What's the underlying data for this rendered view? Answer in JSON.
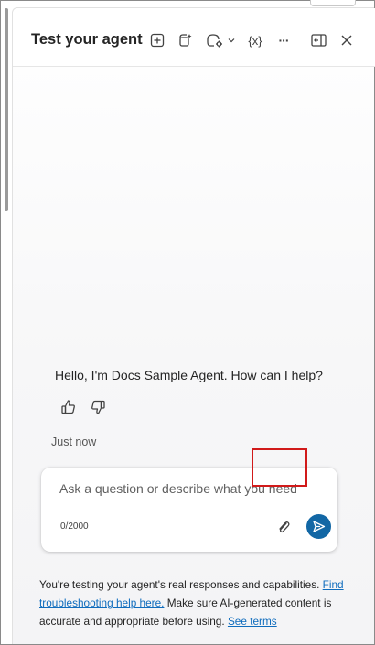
{
  "header": {
    "title": "Test your agent",
    "variables_label": "{x}",
    "more_label": "···"
  },
  "chat": {
    "greeting": "Hello, I'm Docs Sample Agent. How can I help?",
    "timestamp": "Just now"
  },
  "composer": {
    "placeholder": "Ask a question or describe what you need",
    "counter": "0/2000"
  },
  "disclaimer": {
    "text_1": "You're testing your agent's real responses and capabilities. ",
    "link_troubleshooting": "Find troubleshooting help here.",
    "text_2": " Make sure AI-generated content is accurate and appropriate before using. ",
    "link_terms": "See terms"
  },
  "icons": {
    "header": [
      "add-icon",
      "copilot-icon",
      "agent-settings-icon",
      "chevron-down-icon",
      "variables-icon",
      "more-icon",
      "panel-toggle-icon",
      "close-icon"
    ],
    "feedback": [
      "thumbs-up-icon",
      "thumbs-down-icon"
    ],
    "composer": [
      "attach-icon",
      "send-icon"
    ]
  },
  "colors": {
    "accent": "#1267a5",
    "link": "#0f6cbd",
    "highlight": "#d11a1a"
  }
}
